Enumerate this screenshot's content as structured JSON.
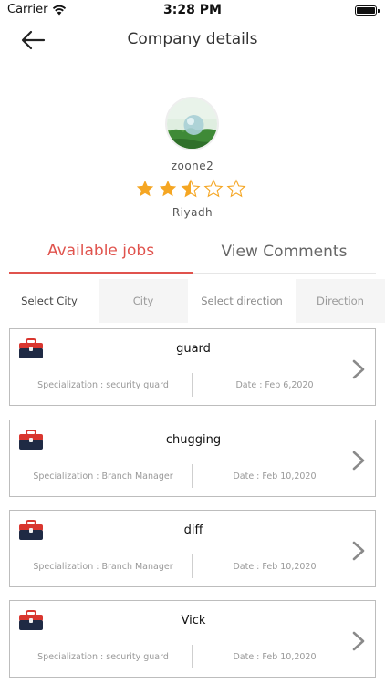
{
  "status": {
    "carrier": "Carrier",
    "time": "3:28 PM"
  },
  "nav": {
    "title": "Company details"
  },
  "company": {
    "name": "zoone2",
    "city": "Riyadh",
    "rating": 2.5,
    "rating_max": 5
  },
  "tabs": [
    {
      "label": "Available jobs",
      "active": true
    },
    {
      "label": "View Comments",
      "active": false
    }
  ],
  "filters": [
    {
      "label": "Select City"
    },
    {
      "label": "City"
    },
    {
      "label": "Select direction"
    },
    {
      "label": "Direction"
    }
  ],
  "jobs": [
    {
      "title": "guard",
      "specialization": "Specialization : security guard",
      "date": "Date : Feb 6,2020"
    },
    {
      "title": "chugging",
      "specialization": "Specialization : Branch Manager",
      "date": "Date : Feb 10,2020"
    },
    {
      "title": "diff",
      "specialization": "Specialization : Branch Manager",
      "date": "Date : Feb 10,2020"
    },
    {
      "title": "Vick",
      "specialization": "Specialization : security guard",
      "date": "Date : Feb 10,2020"
    }
  ],
  "colors": {
    "accent": "#e0534d",
    "star": "#f5a623",
    "icon_navy": "#1f2a44",
    "icon_red": "#d9362f"
  }
}
